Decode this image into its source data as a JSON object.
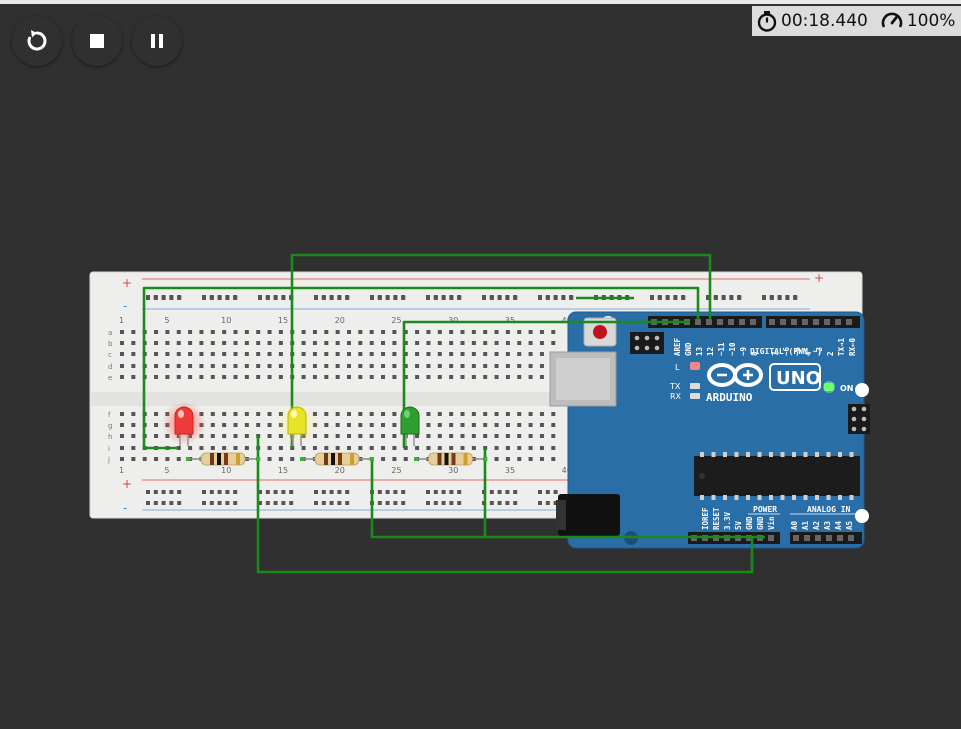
{
  "toolbar": {
    "buttons": [
      {
        "name": "restart-simulation-button",
        "icon": "restart-icon",
        "color": "#4caf50"
      },
      {
        "name": "stop-simulation-button",
        "icon": "stop-icon",
        "color": "#6b6b6b"
      },
      {
        "name": "pause-simulation-button",
        "icon": "pause-icon",
        "color": "#6b6b6b"
      }
    ]
  },
  "status": {
    "timer": "00:18.440",
    "speed": "100%",
    "timer_icon": "stopwatch-icon",
    "speed_icon": "speedometer-icon"
  },
  "breadboard": {
    "columns_top": [
      "1",
      "5",
      "10",
      "15",
      "20",
      "25",
      "30",
      "35",
      "40"
    ],
    "columns_bottom": [
      "1",
      "5",
      "10",
      "15",
      "20",
      "25",
      "30",
      "35",
      "40"
    ],
    "rows_top": [
      "a",
      "b",
      "c",
      "d",
      "e"
    ],
    "rows_bottom": [
      "f",
      "g",
      "h",
      "i",
      "j"
    ],
    "rail_plus": "+",
    "rail_minus": "-"
  },
  "leds": [
    {
      "name": "red-led",
      "color": "#e53935",
      "lit": true
    },
    {
      "name": "yellow-led",
      "color": "#e6e01a",
      "lit": true
    },
    {
      "name": "green-led",
      "color": "#2e9e2e",
      "lit": false
    }
  ],
  "arduino": {
    "brand": "ARDUINO",
    "model": "UNO",
    "digital_label": "DIGITAL (PWM ~)",
    "power_label": "POWER",
    "analog_label": "ANALOG IN",
    "on_label": "ON",
    "l_label": "L",
    "tx_label": "TX",
    "rx_label": "RX",
    "top_pins": [
      "AREF",
      "GND",
      "13",
      "12",
      "~11",
      "~10",
      "~9",
      "8",
      "7",
      "~6",
      "~5",
      "4",
      "~3",
      "2",
      "TX→1",
      "RX←0"
    ],
    "power_pins": [
      "IOREF",
      "RESET",
      "3.3V",
      "5V",
      "GND",
      "GND",
      "Vin"
    ],
    "analog_pins": [
      "A0",
      "A1",
      "A2",
      "A3",
      "A4",
      "A5"
    ],
    "board_color": "#2a6ea8"
  },
  "wire_color": "#1a8a1a"
}
